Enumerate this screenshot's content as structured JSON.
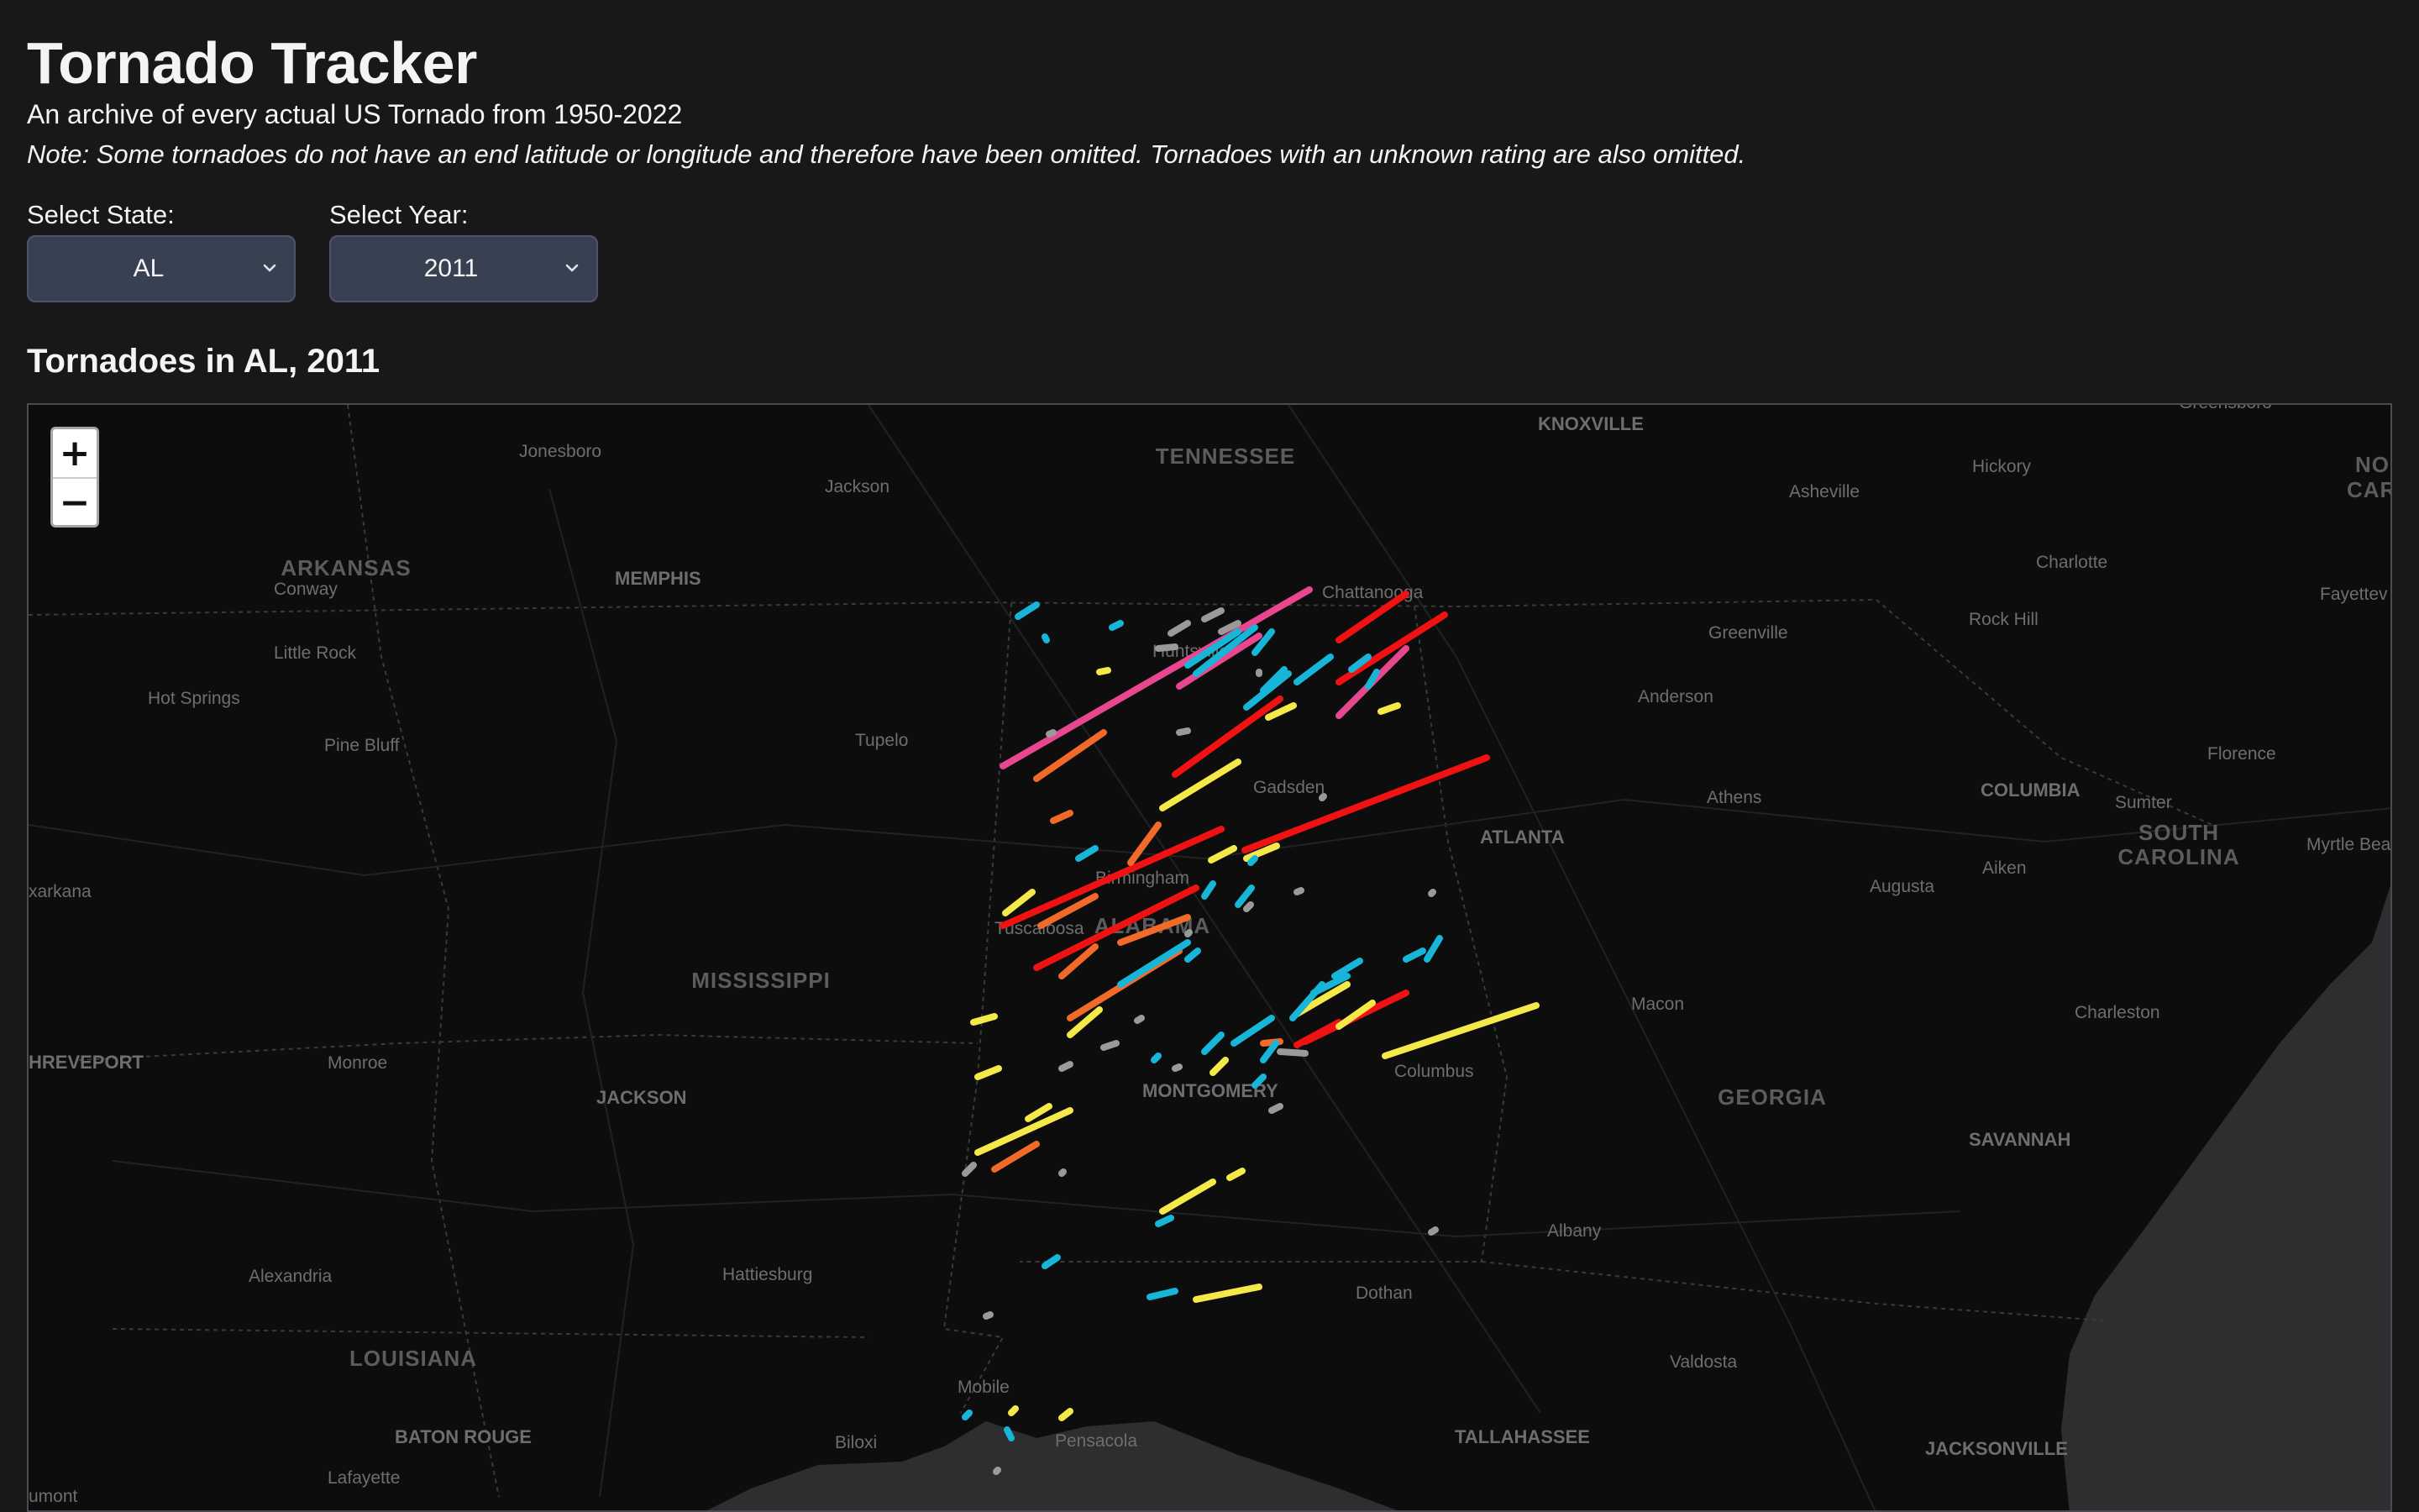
{
  "header": {
    "title": "Tornado Tracker",
    "subtitle": "An archive of every actual US Tornado from 1950-2022",
    "note": "Note: Some tornadoes do not have an end latitude or longitude and therefore have been omitted. Tornadoes with an unknown rating are also omitted."
  },
  "controls": {
    "state_label": "Select State:",
    "state_value": "AL",
    "year_label": "Select Year:",
    "year_value": "2011"
  },
  "map": {
    "heading": "Tornadoes in AL, 2011",
    "zoom_in": "+",
    "zoom_out": "−",
    "state_labels": {
      "tennessee": "TENNESSEE",
      "arkansas": "ARKANSAS",
      "mississippi": "MISSISSIPPI",
      "alabama": "ALABAMA",
      "georgia": "GEORGIA",
      "louisiana": "LOUISIANA",
      "south_carolina_1": "SOUTH",
      "south_carolina_2": "CAROLINA",
      "north_carolina_1": "NO",
      "north_carolina_2": "CAR"
    },
    "cities": {
      "knoxville": "KNOXVILLE",
      "jonesboro": "Jonesboro",
      "jackson_tn": "Jackson",
      "asheville": "Asheville",
      "hickory": "Hickory",
      "greensboro": "Greensboro",
      "conway": "Conway",
      "memphis": "MEMPHIS",
      "chattanooga": "Chattanooga",
      "charlotte": "Charlotte",
      "fayetteville": "Fayettev",
      "little_rock": "Little Rock",
      "huntsville": "Huntsville",
      "greenville": "Greenville",
      "rock_hill": "Rock Hill",
      "hot_springs": "Hot Springs",
      "anderson": "Anderson",
      "tupelo": "Tupelo",
      "pine_bluff": "Pine Bluff",
      "florence": "Florence",
      "gadsden": "Gadsden",
      "columbia": "COLUMBIA",
      "athens": "Athens",
      "sumter": "Sumter",
      "atlanta": "ATLANTA",
      "myrtle_beach": "Myrtle Bea",
      "texarkana": "xarkana",
      "birmingham": "Birmingham",
      "augusta": "Augusta",
      "aiken": "Aiken",
      "tuscaloosa": "Tuscaloosa",
      "macon": "Macon",
      "charleston": "Charleston",
      "shreveport": "HREVEPORT",
      "monroe": "Monroe",
      "columbus": "Columbus",
      "jackson_ms": "JACKSON",
      "montgomery": "MONTGOMERY",
      "savannah": "SAVANNAH",
      "albany": "Albany",
      "alexandria": "Alexandria",
      "hattiesburg": "Hattiesburg",
      "dothan": "Dothan",
      "valdosta": "Valdosta",
      "mobile": "Mobile",
      "baton_rouge": "BATON ROUGE",
      "tallahassee": "TALLAHASSEE",
      "biloxi": "Biloxi",
      "pensacola": "Pensacola",
      "jacksonville": "JACKSONVILLE",
      "lafayette": "Lafayette",
      "houma": "umont"
    },
    "rating_colors": {
      "EF0": "#9a9a9a",
      "EF1": "#17b6d8",
      "EF2": "#f5e94a",
      "EF3": "#f26a2a",
      "EF4": "#f01212",
      "EF5": "#e8478f"
    }
  }
}
